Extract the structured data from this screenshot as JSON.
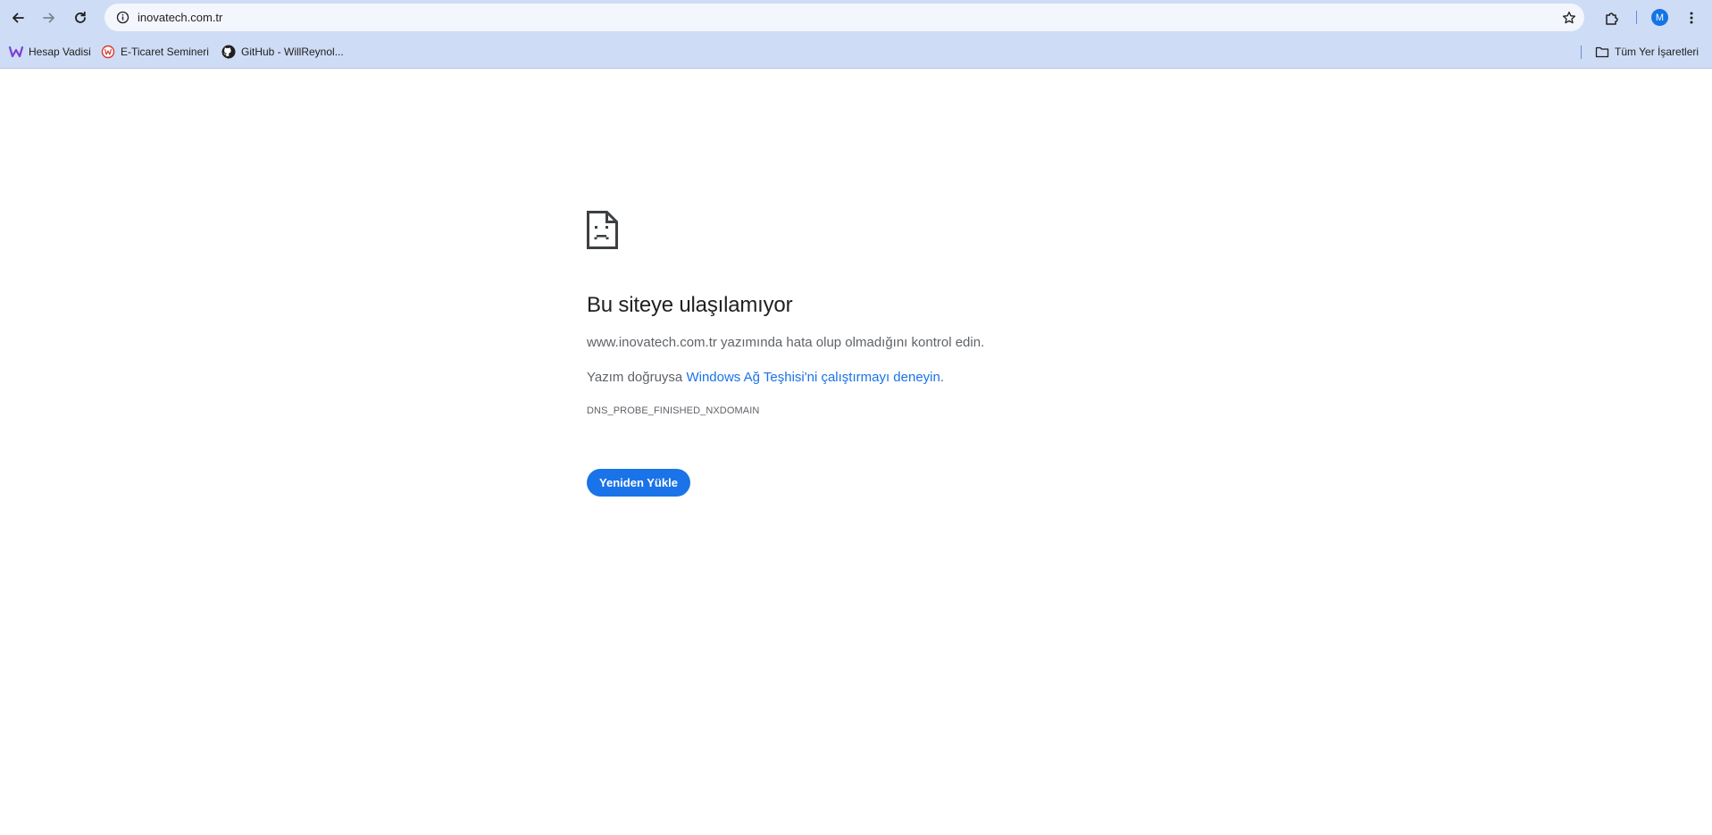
{
  "browser": {
    "url": "inovatech.com.tr",
    "profile_initial": "M",
    "accent_color": "#1a73e8",
    "toolbar_color": "#cfdcf5"
  },
  "toolbar_icons": [
    "back-arrow-icon",
    "forward-arrow-icon",
    "reload-icon",
    "site-info-icon",
    "bookmark-star-icon",
    "extensions-icon",
    "kebab-menu-icon"
  ],
  "bookmarks": {
    "items": [
      {
        "label": "Hesap Vadisi",
        "icon": "hesap-vadisi-favicon"
      },
      {
        "label": "E-Ticaret Semineri",
        "icon": "e-ticaret-favicon"
      },
      {
        "label": "GitHub - WillReynol...",
        "icon": "github-icon"
      }
    ],
    "all_bookmarks": {
      "label": "Tüm Yer İşaretleri",
      "icon": "folder-icon"
    }
  },
  "error_page": {
    "icon": "sad-page-icon",
    "title": "Bu siteye ulaşılamıyor",
    "line1": "www.inovatech.com.tr yazımında hata olup olmadığını kontrol edin.",
    "line2_prefix": "Yazım doğruysa ",
    "line2_link": "Windows Ağ Teşhisi'ni çalıştırmayı deneyin",
    "line2_suffix": ".",
    "error_code": "DNS_PROBE_FINISHED_NXDOMAIN",
    "reload_label": "Yeniden Yükle"
  }
}
